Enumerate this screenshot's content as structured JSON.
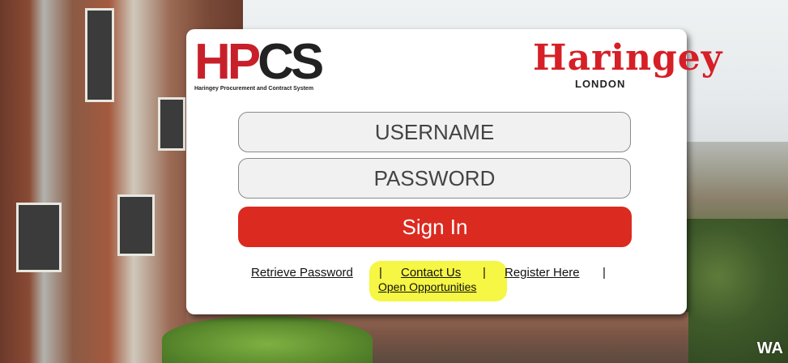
{
  "logos": {
    "hpcs_letters": "HPCS",
    "hpcs_tagline": "Haringey Procurement and Contract System",
    "haringey_word": "Haringey",
    "haringey_sub": "LONDON"
  },
  "form": {
    "username_placeholder": "USERNAME",
    "password_placeholder": "PASSWORD",
    "signin_label": "Sign In"
  },
  "links": {
    "retrieve_password": "Retrieve Password",
    "contact_us": "Contact Us",
    "register_here": "Register Here",
    "open_opportunities": "Open Opportunities",
    "separator": "|"
  },
  "watermark": "WA",
  "colors": {
    "brand_red": "#db2a20",
    "highlight_yellow": "#f6f63a"
  }
}
